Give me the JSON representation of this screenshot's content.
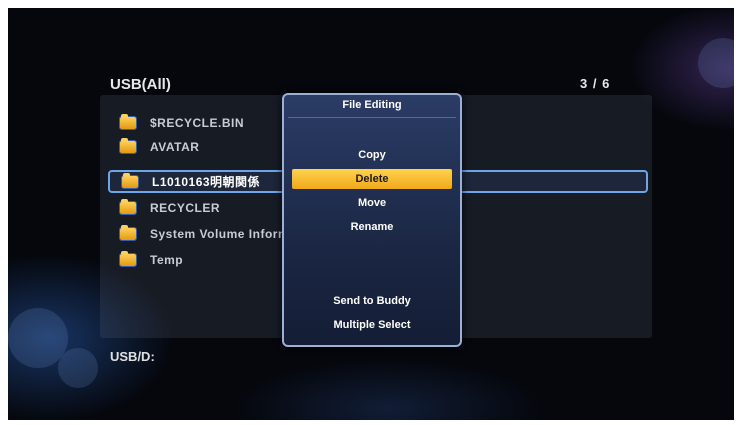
{
  "header": {
    "title": "USB(All)",
    "page_count": "3 / 6"
  },
  "files": [
    {
      "name": "$RECYCLE.BIN"
    },
    {
      "name": "AVATAR"
    },
    {
      "name": "L1010163明朝関係"
    },
    {
      "name": "RECYCLER"
    },
    {
      "name": "System Volume Information"
    },
    {
      "name": "Temp"
    }
  ],
  "footer": {
    "path": "USB/D:"
  },
  "popup": {
    "title": "File Editing",
    "items": [
      {
        "label": "Copy",
        "state": "normal"
      },
      {
        "label": "Delete",
        "state": "highlighted"
      },
      {
        "label": "Move",
        "state": "normal"
      },
      {
        "label": "Rename",
        "state": "normal"
      },
      {
        "label": "",
        "state": "disabled"
      },
      {
        "label": "",
        "state": "disabled"
      },
      {
        "label": "Send to Buddy",
        "state": "normal"
      },
      {
        "label": "Multiple Select",
        "state": "normal"
      }
    ]
  },
  "colors": {
    "highlight": "#f0b429",
    "selection_border": "#6aa6e8",
    "background": "#05070d"
  },
  "icons": {
    "file_item": "folder-icon"
  }
}
